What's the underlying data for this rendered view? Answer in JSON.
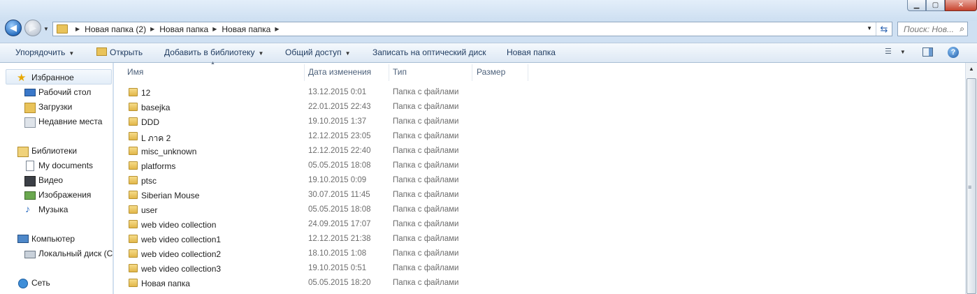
{
  "window": {
    "buttons": {
      "minimize": "▁",
      "maximize": "▢",
      "close": "✕"
    }
  },
  "nav": {
    "back_icon": "arrow-left-icon",
    "forward_icon": "arrow-right-icon",
    "breadcrumbs": [
      "Новая папка (2)",
      "Новая папка",
      "Новая папка"
    ],
    "search_placeholder": "Поиск: Нов..."
  },
  "toolbar": {
    "organize": "Упорядочить",
    "open": "Открыть",
    "add_library": "Добавить в библиотеку",
    "share": "Общий доступ",
    "burn": "Записать на оптический диск",
    "new_folder": "Новая папка"
  },
  "sidebar": {
    "favorites": {
      "label": "Избранное",
      "items": [
        "Рабочий стол",
        "Загрузки",
        "Недавние места"
      ]
    },
    "libraries": {
      "label": "Библиотеки",
      "items": [
        "My documents",
        "Видео",
        "Изображения",
        "Музыка"
      ]
    },
    "computer": {
      "label": "Компьютер",
      "items": [
        "Локальный диск (С"
      ]
    },
    "network": {
      "label": "Сеть"
    }
  },
  "columns": {
    "name": "Имя",
    "date": "Дата изменения",
    "type": "Тип",
    "size": "Размер"
  },
  "files": [
    {
      "name": "12",
      "date": "13.12.2015 0:01",
      "type": "Папка с файлами"
    },
    {
      "name": "basejka",
      "date": "22.01.2015 22:43",
      "type": "Папка с файлами"
    },
    {
      "name": "DDD",
      "date": "19.10.2015 1:37",
      "type": "Папка с файлами"
    },
    {
      "name": "L ภาค 2",
      "date": "12.12.2015 23:05",
      "type": "Папка с файлами"
    },
    {
      "name": "misc_unknown",
      "date": "12.12.2015 22:40",
      "type": "Папка с файлами"
    },
    {
      "name": "platforms",
      "date": "05.05.2015 18:08",
      "type": "Папка с файлами"
    },
    {
      "name": "ptsc",
      "date": "19.10.2015 0:09",
      "type": "Папка с файлами"
    },
    {
      "name": "Siberian Mouse",
      "date": "30.07.2015 11:45",
      "type": "Папка с файлами"
    },
    {
      "name": "user",
      "date": "05.05.2015 18:08",
      "type": "Папка с файлами"
    },
    {
      "name": "web video collection",
      "date": "24.09.2015 17:07",
      "type": "Папка с файлами"
    },
    {
      "name": "web video collection1",
      "date": "12.12.2015 21:38",
      "type": "Папка с файлами"
    },
    {
      "name": "web video collection2",
      "date": "18.10.2015 1:08",
      "type": "Папка с файлами"
    },
    {
      "name": "web video collection3",
      "date": "19.10.2015 0:51",
      "type": "Папка с файлами"
    },
    {
      "name": "Новая папка",
      "date": "05.05.2015 18:20",
      "type": "Папка с файлами"
    }
  ]
}
